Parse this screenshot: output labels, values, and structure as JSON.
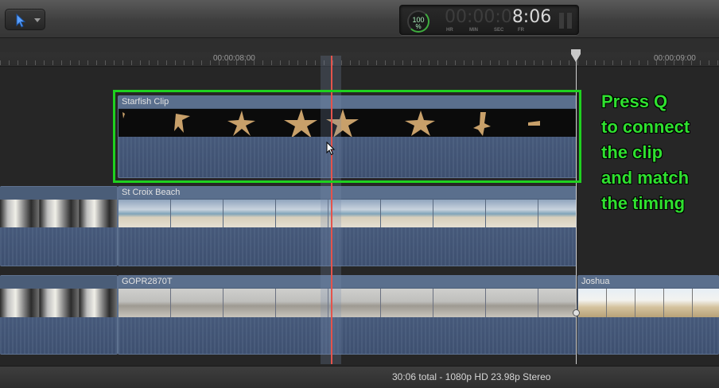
{
  "toolbar": {
    "tool_icon": "select-arrow-icon",
    "meter_value": "100",
    "meter_unit": "%",
    "timecode_dim": "00:00:0",
    "timecode_lit": "8:06",
    "timecode_units": {
      "hr": "HR",
      "min": "MIN",
      "sec": "SEC",
      "fr": "FR"
    }
  },
  "ruler": {
    "labels": [
      "00:00:08:00",
      "00:00:09:00"
    ]
  },
  "clips": {
    "starfish": {
      "title": "Starfish Clip"
    },
    "st_croix": {
      "title": "St Croix Beach"
    },
    "gopr": {
      "title": "GOPR2870T"
    },
    "joshua": {
      "title": "Joshua"
    }
  },
  "annotation": {
    "lines": [
      "Press Q",
      "to connect",
      "the clip",
      "and match",
      "the timing"
    ],
    "color": "#2fe02f"
  },
  "status": {
    "text": "30:06 total - 1080p HD 23.98p Stereo"
  },
  "colors": {
    "highlight": "#1fd11f",
    "playhead": "#e5534b",
    "clip_body": "#4a5d78"
  }
}
